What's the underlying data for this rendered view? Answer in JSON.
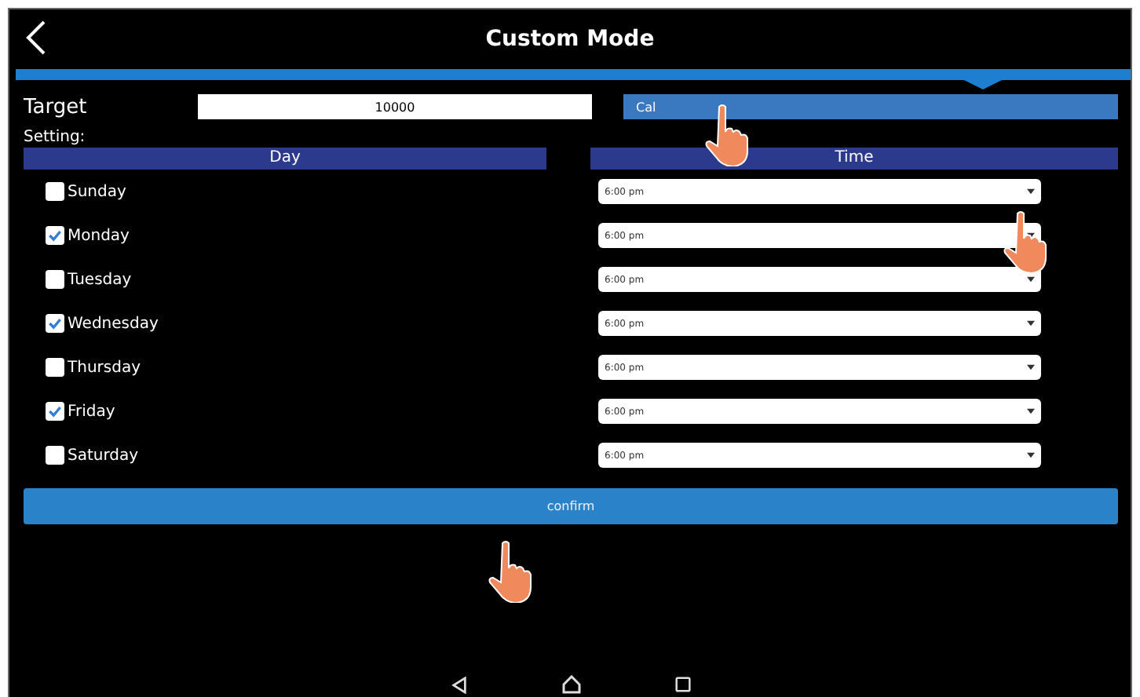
{
  "header": {
    "title": "Custom Mode"
  },
  "target": {
    "label": "Target",
    "value": "10000",
    "unit": "Cal"
  },
  "setting_label": "Setting:",
  "columns": [
    "Day",
    "Time"
  ],
  "days": [
    {
      "day": "Sunday",
      "checked": false,
      "time": "6:00 pm"
    },
    {
      "day": "Monday",
      "checked": true,
      "time": "6:00 pm"
    },
    {
      "day": "Tuesday",
      "checked": false,
      "time": "6:00 pm"
    },
    {
      "day": "Wednesday",
      "checked": true,
      "time": "6:00 pm"
    },
    {
      "day": "Thursday",
      "checked": false,
      "time": "6:00 pm"
    },
    {
      "day": "Friday",
      "checked": true,
      "time": "6:00 pm"
    },
    {
      "day": "Saturday",
      "checked": false,
      "time": "6:00 pm"
    }
  ],
  "confirm": "confirm"
}
